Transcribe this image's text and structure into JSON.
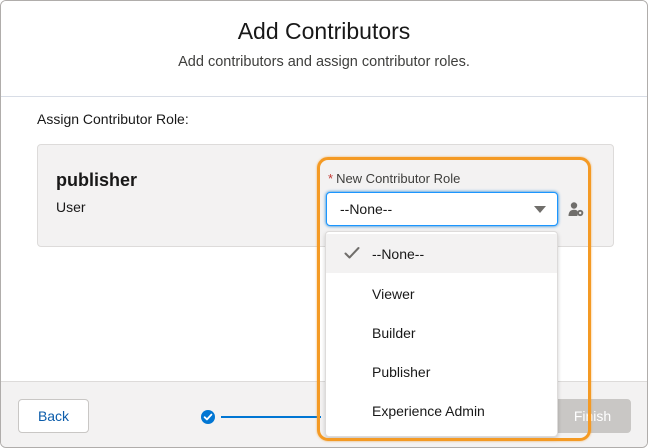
{
  "header": {
    "title": "Add Contributors",
    "subtitle": "Add contributors and assign contributor roles."
  },
  "section_label": "Assign Contributor Role:",
  "contributor": {
    "name": "publisher",
    "type": "User"
  },
  "role_field": {
    "required_marker": "*",
    "label": "New Contributor Role",
    "selected_value": "--None--"
  },
  "dropdown": {
    "options": [
      {
        "label": "--None--",
        "selected": true
      },
      {
        "label": "Viewer",
        "selected": false
      },
      {
        "label": "Builder",
        "selected": false
      },
      {
        "label": "Publisher",
        "selected": false
      },
      {
        "label": "Experience Admin",
        "selected": false
      }
    ]
  },
  "footer": {
    "back_label": "Back",
    "finish_label": "Finish"
  },
  "colors": {
    "accent": "#0176d3",
    "highlight": "#f49a24",
    "required": "#c23934"
  },
  "icons": {
    "field_action": "person-settings-icon",
    "selected_option": "check-icon",
    "select_toggle": "chevron-down-icon"
  }
}
